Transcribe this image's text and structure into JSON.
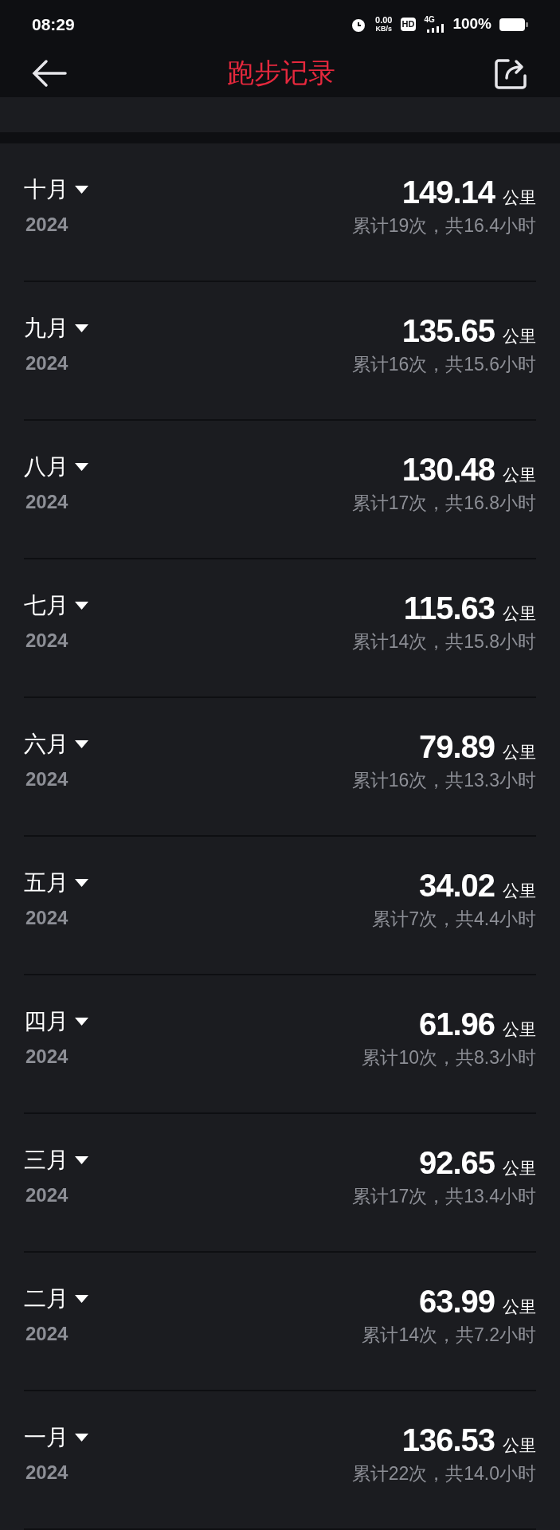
{
  "status_bar": {
    "time": "08:29",
    "net_speed": "0.00",
    "net_unit": "KB/s",
    "hd": "HD",
    "network": "4G",
    "battery": "100%"
  },
  "header": {
    "title": "跑步记录"
  },
  "months": [
    {
      "month": "十月",
      "year": "2024",
      "distance": "149.14",
      "unit": "公里",
      "summary": "累计19次，共16.4小时"
    },
    {
      "month": "九月",
      "year": "2024",
      "distance": "135.65",
      "unit": "公里",
      "summary": "累计16次，共15.6小时"
    },
    {
      "month": "八月",
      "year": "2024",
      "distance": "130.48",
      "unit": "公里",
      "summary": "累计17次，共16.8小时"
    },
    {
      "month": "七月",
      "year": "2024",
      "distance": "115.63",
      "unit": "公里",
      "summary": "累计14次，共15.8小时"
    },
    {
      "month": "六月",
      "year": "2024",
      "distance": "79.89",
      "unit": "公里",
      "summary": "累计16次，共13.3小时"
    },
    {
      "month": "五月",
      "year": "2024",
      "distance": "34.02",
      "unit": "公里",
      "summary": "累计7次，共4.4小时"
    },
    {
      "month": "四月",
      "year": "2024",
      "distance": "61.96",
      "unit": "公里",
      "summary": "累计10次，共8.3小时"
    },
    {
      "month": "三月",
      "year": "2024",
      "distance": "92.65",
      "unit": "公里",
      "summary": "累计17次，共13.4小时"
    },
    {
      "month": "二月",
      "year": "2024",
      "distance": "63.99",
      "unit": "公里",
      "summary": "累计14次，共7.2小时"
    },
    {
      "month": "一月",
      "year": "2024",
      "distance": "136.53",
      "unit": "公里",
      "summary": "累计22次，共14.0小时"
    }
  ]
}
